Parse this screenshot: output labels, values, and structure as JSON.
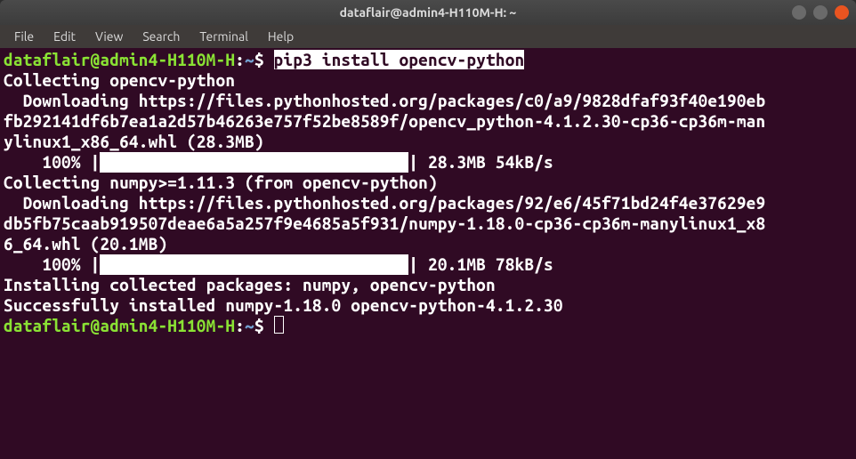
{
  "window": {
    "title": "dataflair@admin4-H110M-H: ~"
  },
  "menu": {
    "file": "File",
    "edit": "Edit",
    "view": "View",
    "search": "Search",
    "terminal": "Terminal",
    "help": "Help"
  },
  "prompt": {
    "user_host": "dataflair@admin4-H110M-H",
    "colon": ":",
    "path": "~",
    "symbol": "$"
  },
  "lines": {
    "cmd1": "pip3 install opencv-python",
    "l2": "Collecting opencv-python",
    "l3": "  Downloading https://files.pythonhosted.org/packages/c0/a9/9828dfaf93f40e190eb",
    "l4": "fb292141df6b7ea1a2d57b46263e757f52be8589f/opencv_python-4.1.2.30-cp36-cp36m-man",
    "l5": "ylinux1_x86_64.whl (28.3MB)",
    "l6a": "    100% |",
    "l6b": "                                ",
    "l6c": "| 28.3MB 54kB/s ",
    "l7": "Collecting numpy>=1.11.3 (from opencv-python)",
    "l8": "  Downloading https://files.pythonhosted.org/packages/92/e6/45f71bd24f4e37629e9",
    "l9": "db5fb75caab919507deae6a5a257f9e4685a5f931/numpy-1.18.0-cp36-cp36m-manylinux1_x8",
    "l10": "6_64.whl (20.1MB)",
    "l11a": "    100% |",
    "l11b": "                                ",
    "l11c": "| 20.1MB 78kB/s ",
    "l12": "Installing collected packages: numpy, opencv-python",
    "l13": "Successfully installed numpy-1.18.0 opencv-python-4.1.2.30"
  }
}
